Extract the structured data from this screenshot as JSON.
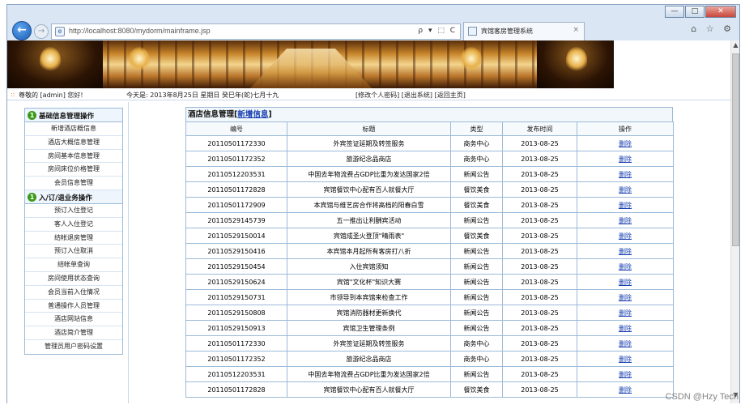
{
  "browser": {
    "url": "http://localhost:8080/mydorm/mainframe.jsp",
    "addr_tools": "ρ ▾ ⬚ C",
    "tab_title": "宾馆客房管理系统",
    "tab_close": "×",
    "right_tools": "⌂ ☆ ⚙",
    "win_min": "—",
    "win_max": "□",
    "win_close": "✕",
    "back": "←",
    "forward": "→"
  },
  "infobar": {
    "bullet": "::",
    "greeting": "尊敬的 [admin] 您好!",
    "date": "今天是:  2013年8月25日  星期日  癸巳年(蛇)七月十九",
    "links": "[修改个人密码] [退出系统] [返回主页]"
  },
  "menu": [
    {
      "icon": "1",
      "title": "基础信息管理操作",
      "items": [
        "新增酒店概信息",
        "酒店大概信息管理",
        "房间基本信息管理",
        "房间床位价格管理",
        "会员信息管理"
      ]
    },
    {
      "icon": "1",
      "title": "入/订/退业务操作",
      "items": [
        "预订入住登记",
        "客人入住登记",
        "结帐退房管理",
        "预订入住取消",
        "结帐单查询",
        "房间使用状态查询",
        "会员当前入住情况",
        "普通操作人员管理",
        "酒店网站信息",
        "酒店简介管理",
        "管理员用户密码设置"
      ]
    }
  ],
  "main": {
    "caption": "酒店信息管理",
    "caption_open": "[",
    "caption_link": "新增信息",
    "caption_close": "]",
    "headers": [
      "编号",
      "标题",
      "类型",
      "发布时间",
      "操作"
    ],
    "rows": [
      [
        "20110501172330",
        "外宾签证延期及转签服务",
        "商务中心",
        "2013-08-25",
        "删除"
      ],
      [
        "20110501172352",
        "旅游纪念品商店",
        "商务中心",
        "2013-08-25",
        "删除"
      ],
      [
        "20110512203531",
        "中国去年物流费占GDP比重为发达国家2倍",
        "新闻公告",
        "2013-08-25",
        "删除"
      ],
      [
        "20110501172828",
        "宾馆餐饮中心配有百人就餐大厅",
        "餐饮美食",
        "2013-08-25",
        "删除"
      ],
      [
        "20110501172909",
        "本宾馆与维艺房合作将高档的阳春白雪",
        "餐饮美食",
        "2013-08-25",
        "删除"
      ],
      [
        "20110529145739",
        "五一推出让利酬宾活动",
        "新闻公告",
        "2013-08-25",
        "删除"
      ],
      [
        "20110529150014",
        "宾馆成圣火登顶\"晴雨表\"",
        "餐饮美食",
        "2013-08-25",
        "删除"
      ],
      [
        "20110529150416",
        "本宾馆本月起所有客房打八折",
        "新闻公告",
        "2013-08-25",
        "删除"
      ],
      [
        "20110529150454",
        "入住宾馆须知",
        "新闻公告",
        "2013-08-25",
        "删除"
      ],
      [
        "20110529150624",
        "宾馆\"文化杯\"知识大赛",
        "新闻公告",
        "2013-08-25",
        "删除"
      ],
      [
        "20110529150731",
        "市领导到本宾馆来检查工作",
        "新闻公告",
        "2013-08-25",
        "删除"
      ],
      [
        "20110529150808",
        "宾馆消防器材更新换代",
        "新闻公告",
        "2013-08-25",
        "删除"
      ],
      [
        "20110529150913",
        "宾馆卫生管理条例",
        "新闻公告",
        "2013-08-25",
        "删除"
      ],
      [
        "20110501172330",
        "外宾签证延期及转签服务",
        "商务中心",
        "2013-08-25",
        "删除"
      ],
      [
        "20110501172352",
        "旅游纪念品商店",
        "商务中心",
        "2013-08-25",
        "删除"
      ],
      [
        "20110512203531",
        "中国去年物流费占GDP比重为发达国家2倍",
        "新闻公告",
        "2013-08-25",
        "删除"
      ],
      [
        "20110501172828",
        "宾馆餐饮中心配有百人就餐大厅",
        "餐饮美食",
        "2013-08-25",
        "删除"
      ]
    ]
  },
  "watermark": "CSDN @Hzy Tech"
}
